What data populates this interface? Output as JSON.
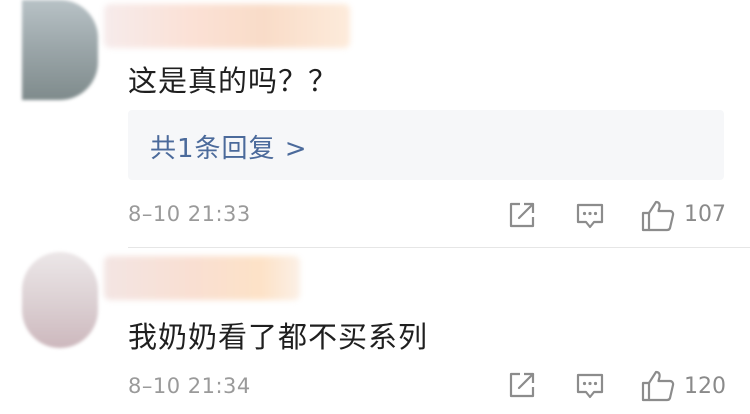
{
  "comments": [
    {
      "text": "这是真的吗？？",
      "replies_label": "共1条回复 >",
      "time": "8–10 21:33",
      "like_count": "107"
    },
    {
      "text": "我奶奶看了都不买系列",
      "time": "8–10 21:34",
      "like_count": "120"
    }
  ],
  "icons": {
    "forward": "share-square-icon",
    "comment": "speech-bubble-icon",
    "like": "thumbs-up-icon"
  },
  "colors": {
    "text": "#1f1f1f",
    "link": "#4b6a9b",
    "meta": "#9a9a9a",
    "reply_bg": "#f6f7f9"
  }
}
